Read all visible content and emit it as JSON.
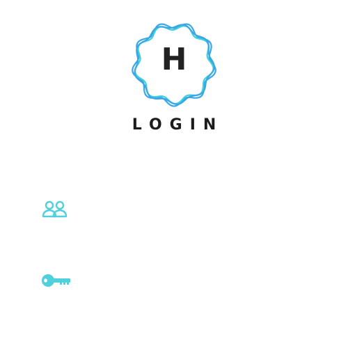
{
  "logo": {
    "letter": "H",
    "ring_colors": [
      "#3aa6e8",
      "#3fd0d9"
    ]
  },
  "login": {
    "title": "LOGIN"
  },
  "fields": {
    "username": {
      "icon": "users-icon",
      "value": "",
      "placeholder": ""
    },
    "password": {
      "icon": "key-icon",
      "value": "",
      "placeholder": ""
    }
  },
  "colors": {
    "accent": "#4fd0db",
    "text": "#1c1c1c",
    "background": "#ffffff"
  }
}
